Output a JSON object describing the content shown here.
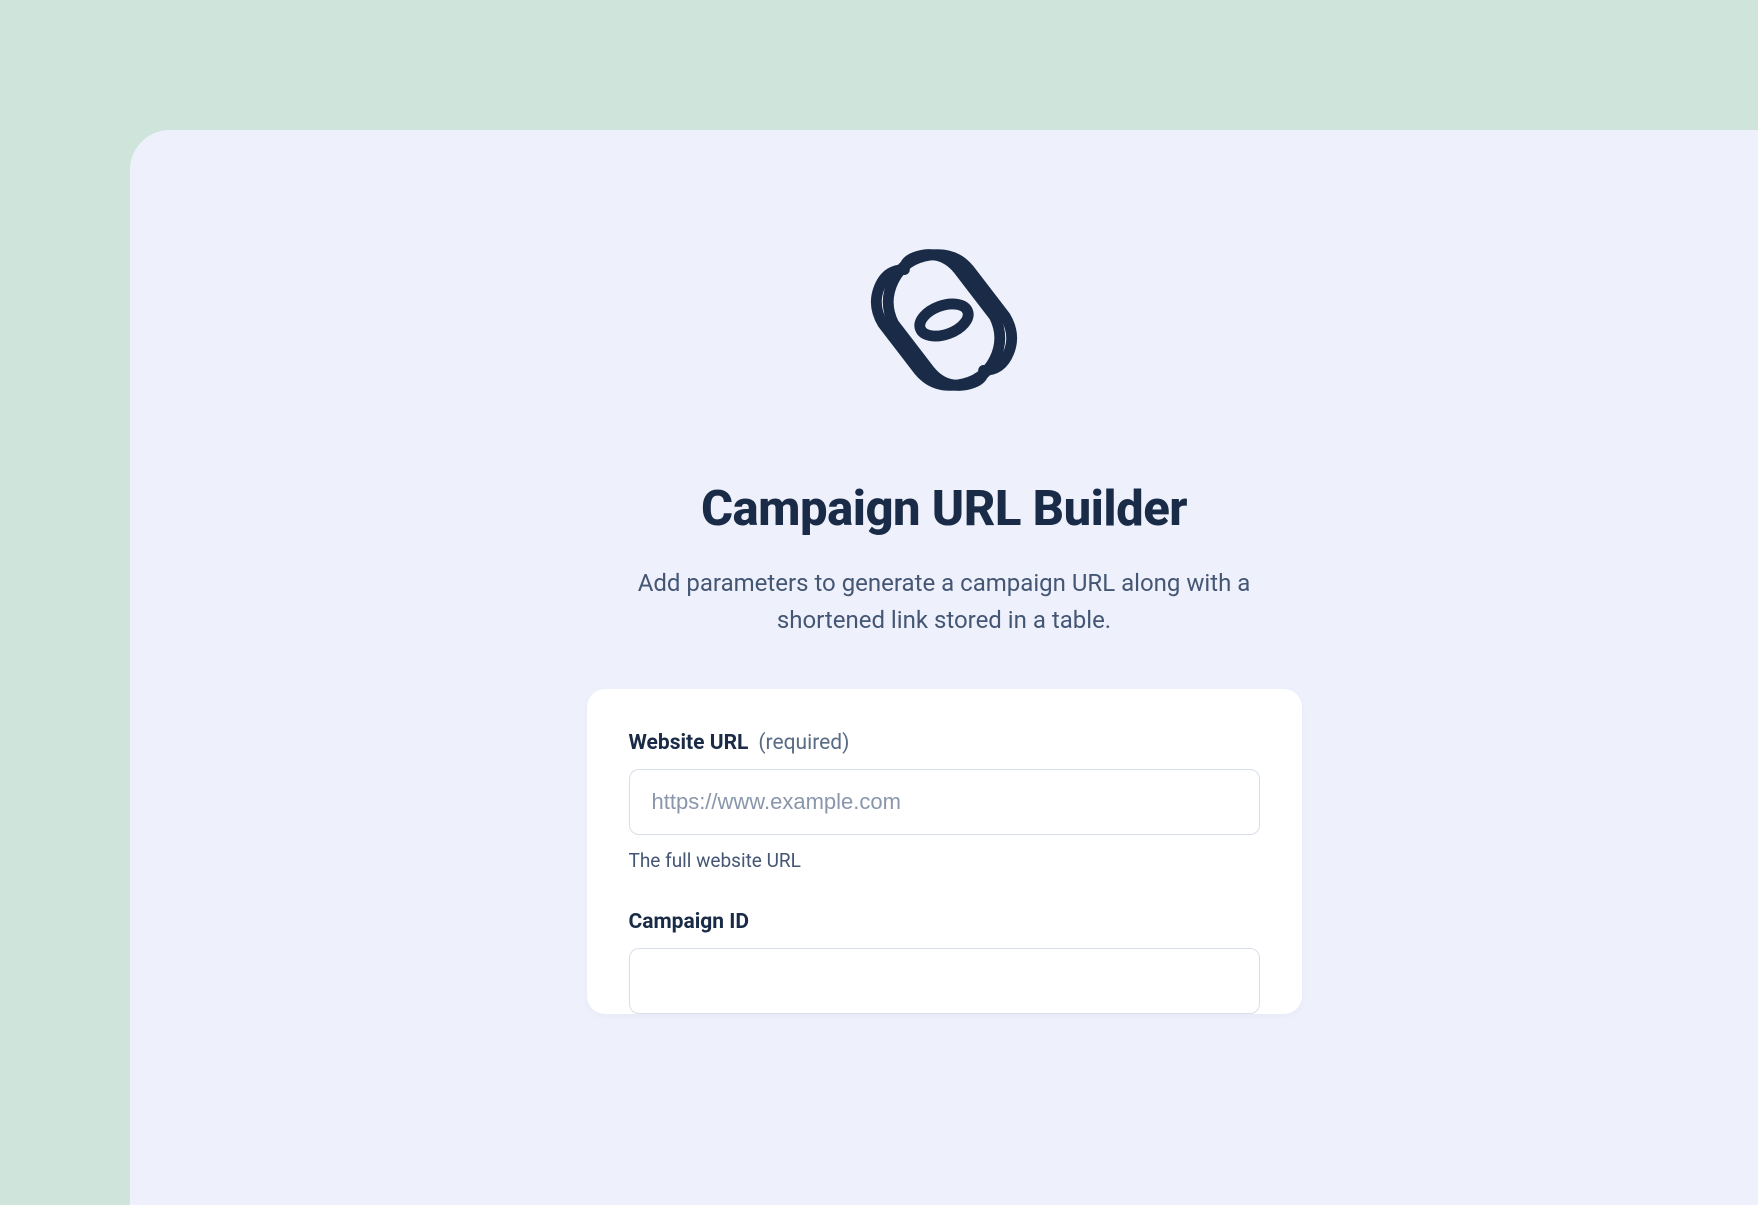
{
  "header": {
    "title": "Campaign URL Builder",
    "subtitle": "Add parameters to generate a campaign URL along with a shortened link stored in a table."
  },
  "form": {
    "website_url": {
      "label": "Website URL",
      "suffix": "(required)",
      "placeholder": "https://www.example.com",
      "value": "",
      "help": "The full website URL"
    },
    "campaign_id": {
      "label": "Campaign ID",
      "placeholder": "",
      "value": ""
    }
  },
  "logo": {
    "name": "knot-logo-icon"
  }
}
